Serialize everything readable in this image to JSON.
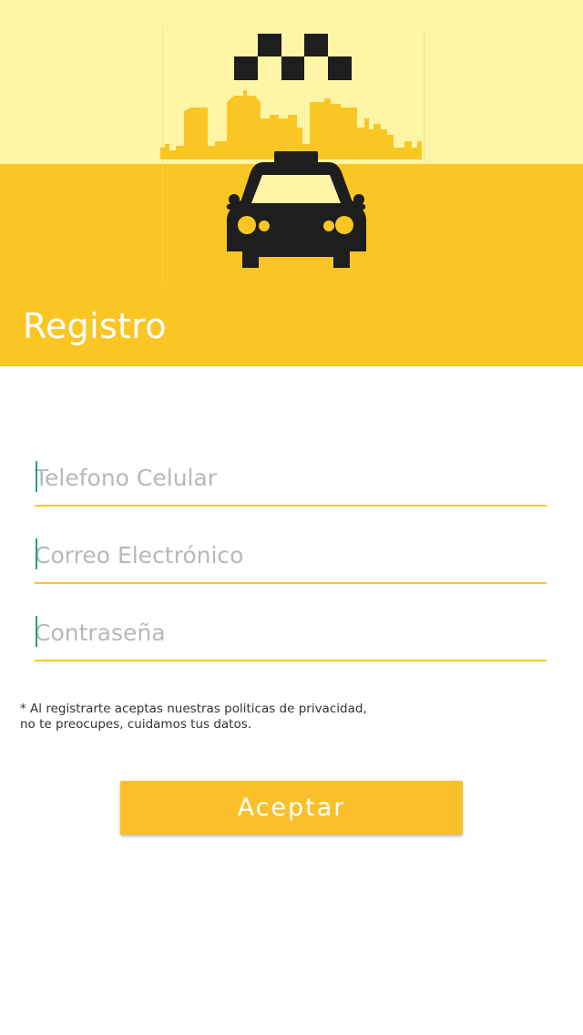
{
  "header": {
    "title": "Registro",
    "colors": {
      "sky": "#fff5a6",
      "brand": "#f9c623",
      "ink": "#1e1e1e"
    },
    "illustration": "taxi-city-icon"
  },
  "form": {
    "phone_placeholder": "Telefono Celular",
    "email_placeholder": "Correo Electrónico",
    "password_placeholder": "Contraseña"
  },
  "privacy_note": {
    "line1": "* Al registrarte aceptas nuestras politicas de privacidad,",
    "line2": "no te preocupes, cuidamos tus datos."
  },
  "submit": {
    "label": "Aceptar",
    "color": "#f9c02b"
  }
}
